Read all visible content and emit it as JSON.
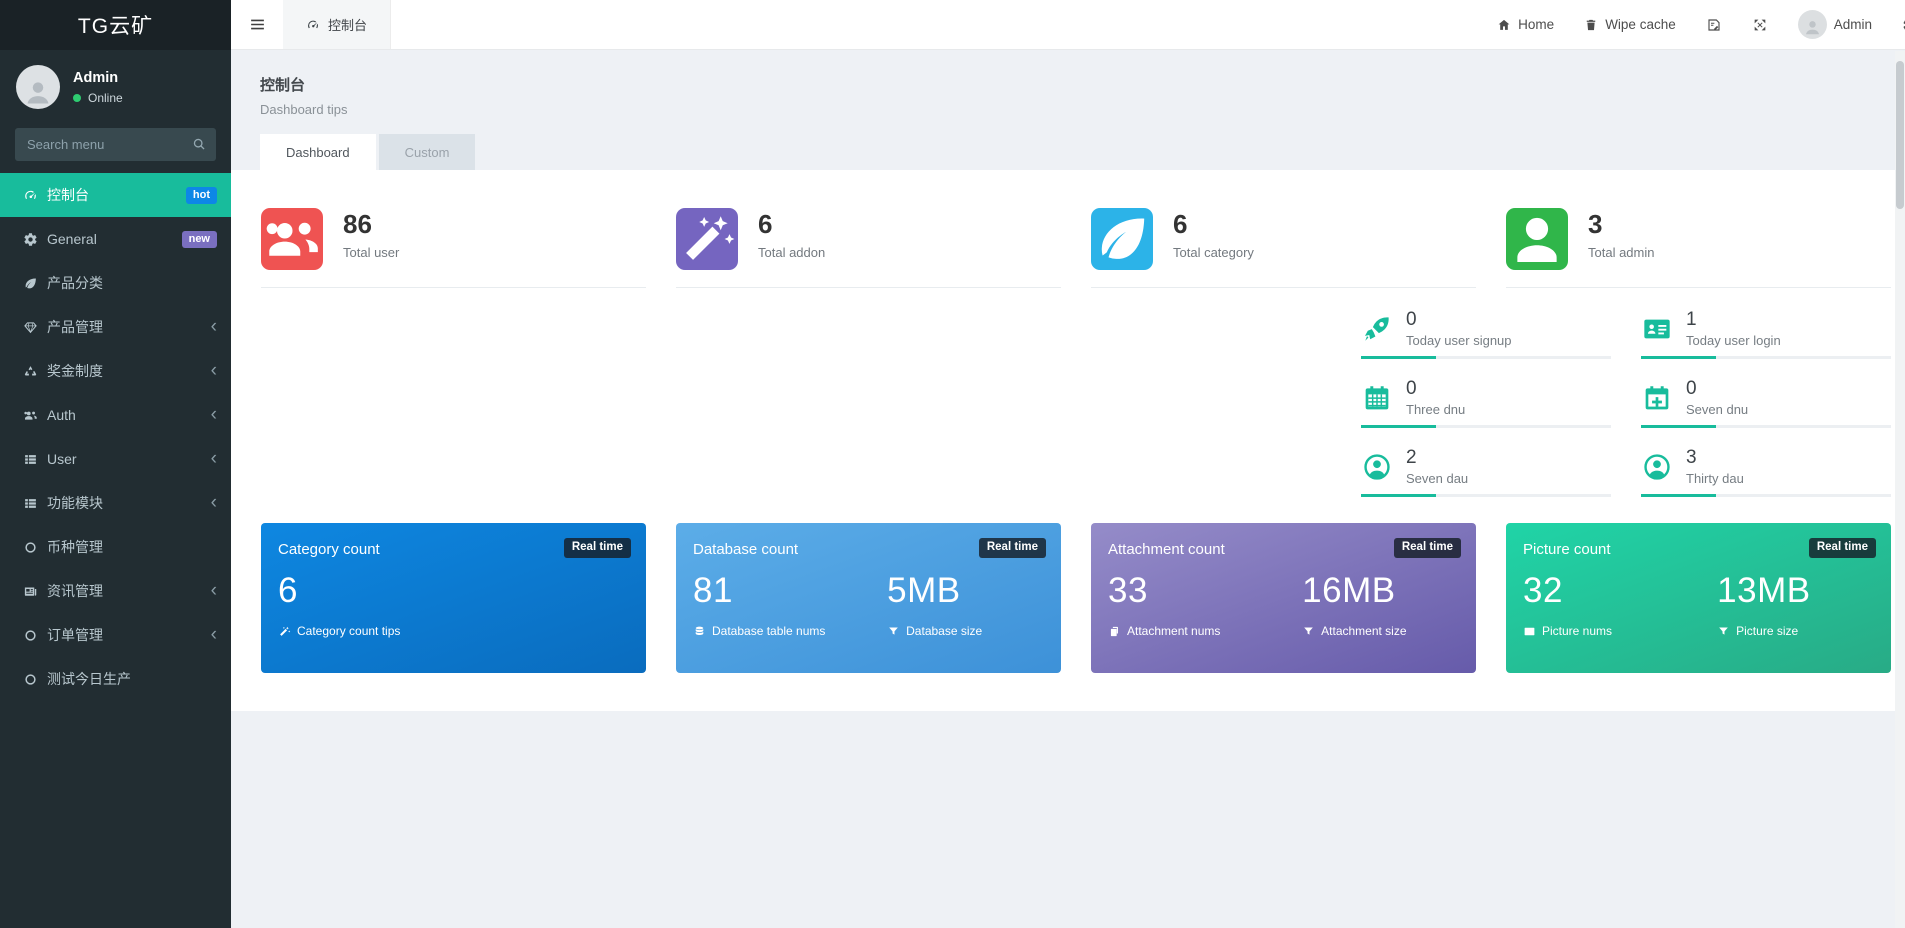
{
  "colors": {
    "accent": "#18bc9c",
    "sidebar_bg": "#222d32",
    "logo_bg": "#1a2226",
    "page_bg": "#eef1f5",
    "online_dot": "#2ecc71"
  },
  "sidebar": {
    "logo": "TG云矿",
    "user": {
      "name": "Admin",
      "status": "Online"
    },
    "search": {
      "placeholder": "Search menu",
      "icon": "search-icon"
    },
    "menu": [
      {
        "label": "控制台",
        "icon": "gauge-icon",
        "badge": "hot",
        "badge_color": "#0d87e6",
        "active": true,
        "arrow": false
      },
      {
        "label": "General",
        "icon": "cogs-icon",
        "badge": "new",
        "badge_color": "#7a6fc0",
        "active": false,
        "arrow": false
      },
      {
        "label": "产品分类",
        "icon": "leaf-icon",
        "badge": "",
        "active": false,
        "arrow": false
      },
      {
        "label": "产品管理",
        "icon": "gem-icon",
        "badge": "",
        "active": false,
        "arrow": true
      },
      {
        "label": "奖金制度",
        "icon": "recycle-icon",
        "badge": "",
        "active": false,
        "arrow": true
      },
      {
        "label": "Auth",
        "icon": "users-icon",
        "badge": "",
        "active": false,
        "arrow": true
      },
      {
        "label": "User",
        "icon": "list-icon",
        "badge": "",
        "active": false,
        "arrow": true
      },
      {
        "label": "功能模块",
        "icon": "list-icon",
        "badge": "",
        "active": false,
        "arrow": true
      },
      {
        "label": "币种管理",
        "icon": "circle-icon",
        "badge": "",
        "active": false,
        "arrow": false
      },
      {
        "label": "资讯管理",
        "icon": "newspaper-icon",
        "badge": "",
        "active": false,
        "arrow": true
      },
      {
        "label": "订单管理",
        "icon": "circle-icon",
        "badge": "",
        "active": false,
        "arrow": true
      },
      {
        "label": "测试今日生产",
        "icon": "circle-icon",
        "badge": "",
        "active": false,
        "arrow": false
      }
    ]
  },
  "topbar": {
    "toggle_icon": "bars-icon",
    "tab_label": "控制台",
    "tab_icon": "gauge-icon",
    "home_label": "Home",
    "home_icon": "home-icon",
    "wipe_label": "Wipe cache",
    "wipe_icon": "trash-icon",
    "language_icon": "language-icon",
    "fullscreen_icon": "expand-icon",
    "admin_label": "Admin",
    "settings_icon": "cogs-icon"
  },
  "content": {
    "header": {
      "title": "控制台",
      "subtitle": "Dashboard tips"
    },
    "tabs": [
      {
        "label": "Dashboard",
        "active": true
      },
      {
        "label": "Custom",
        "active": false
      }
    ],
    "totals": [
      {
        "value": "86",
        "label": "Total user",
        "icon": "users-icon",
        "color": "#ef5352"
      },
      {
        "value": "6",
        "label": "Total addon",
        "icon": "magic-icon",
        "color": "#7565c0"
      },
      {
        "value": "6",
        "label": "Total category",
        "icon": "leaf-icon",
        "color": "#2cb3e8"
      },
      {
        "value": "3",
        "label": "Total admin",
        "icon": "user-icon",
        "color": "#30b64a"
      }
    ],
    "mini_stats": [
      {
        "value": "0",
        "label": "Today user signup",
        "icon": "rocket-icon"
      },
      {
        "value": "1",
        "label": "Today user login",
        "icon": "id-card-icon"
      },
      {
        "value": "0",
        "label": "Three dnu",
        "icon": "calendar-icon"
      },
      {
        "value": "0",
        "label": "Seven dnu",
        "icon": "calendar-plus-icon"
      },
      {
        "value": "2",
        "label": "Seven dau",
        "icon": "user-circle-icon"
      },
      {
        "value": "3",
        "label": "Thirty dau",
        "icon": "user-circle-icon"
      }
    ],
    "cards": [
      {
        "title": "Category count",
        "badge": "Real time",
        "bg": [
          "#0e87e1",
          "#0a6cbe"
        ],
        "cols": [
          {
            "value": "6",
            "label": "Category count tips",
            "icon": "magic-icon"
          }
        ]
      },
      {
        "title": "Database count",
        "badge": "Real time",
        "bg": [
          "#5cade8",
          "#3d91d8"
        ],
        "cols": [
          {
            "value": "81",
            "label": "Database table nums",
            "icon": "database-icon"
          },
          {
            "value": "5MB",
            "label": "Database size",
            "icon": "filter-icon"
          }
        ]
      },
      {
        "title": "Attachment count",
        "badge": "Real time",
        "bg": [
          "#958cc9",
          "#665baa"
        ],
        "cols": [
          {
            "value": "33",
            "label": "Attachment nums",
            "icon": "copy-icon"
          },
          {
            "value": "16MB",
            "label": "Attachment size",
            "icon": "filter-icon"
          }
        ]
      },
      {
        "title": "Picture count",
        "badge": "Real time",
        "bg": [
          "#20d4a7",
          "#28ab86"
        ],
        "cols": [
          {
            "value": "32",
            "label": "Picture nums",
            "icon": "image-icon"
          },
          {
            "value": "13MB",
            "label": "Picture size",
            "icon": "filter-icon"
          }
        ]
      }
    ]
  }
}
